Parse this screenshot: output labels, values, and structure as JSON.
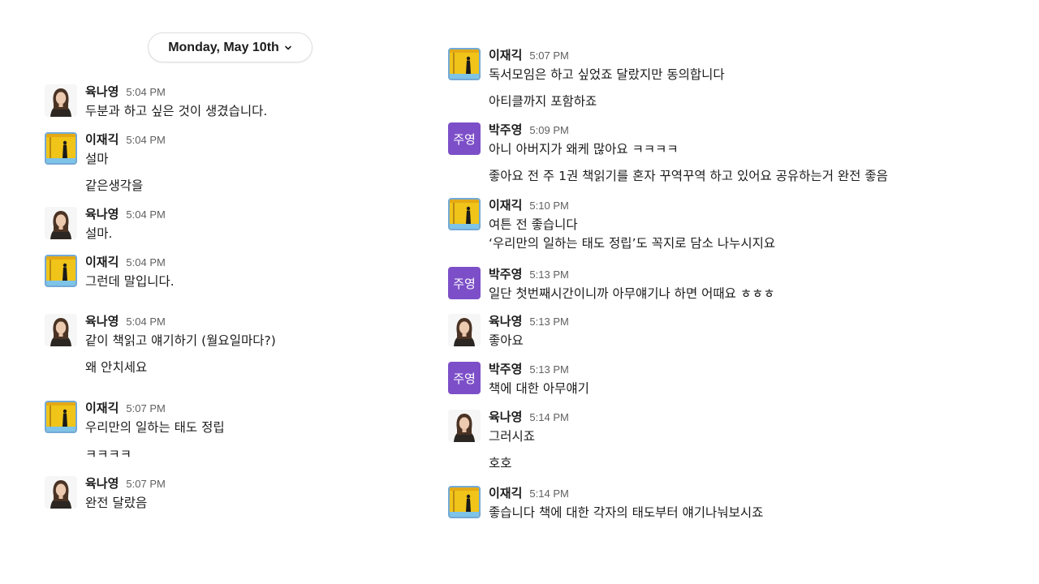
{
  "date_divider": {
    "label": "Monday, May 10th"
  },
  "avatar_labels": {
    "park": "주영"
  },
  "left_messages": [
    {
      "author": "육나영",
      "time": "5:04 PM",
      "avatar": "person",
      "lines": [
        "두분과 하고 싶은 것이 생겼습니다."
      ]
    },
    {
      "author": "이재긱",
      "time": "5:04 PM",
      "avatar": "art",
      "lines": [
        "설마",
        "같은생각을"
      ]
    },
    {
      "author": "육나영",
      "time": "5:04 PM",
      "avatar": "person",
      "lines": [
        "설마."
      ]
    },
    {
      "author": "이재긱",
      "time": "5:04 PM",
      "avatar": "art",
      "lines": [
        "그런데 말입니다."
      ]
    },
    {
      "author": "육나영",
      "time": "5:04 PM",
      "avatar": "person",
      "lines": [
        "같이 책읽고 얘기하기 (월요일마다?)",
        "왜 안치세요"
      ]
    },
    {
      "author": "이재긱",
      "time": "5:07 PM",
      "avatar": "art",
      "lines": [
        "우리만의 일하는 태도 정립",
        "ㅋㅋㅋㅋ"
      ]
    },
    {
      "author": "육나영",
      "time": "5:07 PM",
      "avatar": "person",
      "lines": [
        "완전 달랐음"
      ]
    }
  ],
  "right_messages": [
    {
      "author": "이재긱",
      "time": "5:07 PM",
      "avatar": "art",
      "lines": [
        "독서모임은 하고 싶었죠 달랐지만 동의합니다",
        "아티클까지 포함하죠"
      ]
    },
    {
      "author": "박주영",
      "time": "5:09 PM",
      "avatar": "text",
      "lines": [
        "아니 아버지가 왜케 많아요 ㅋㅋㅋㅋ",
        "좋아요 전 주 1권 책읽기를 혼자 꾸역꾸역 하고 있어요 공유하는거 완전 좋음"
      ]
    },
    {
      "author": "이재긱",
      "time": "5:10 PM",
      "avatar": "art",
      "lines": [
        "여튼 전 좋습니다",
        "‘우리만의 일하는 태도 정립’도 꼭지로 담소 나누시지요"
      ],
      "no_gap": true
    },
    {
      "author": "박주영",
      "time": "5:13 PM",
      "avatar": "text",
      "lines": [
        "일단 첫번째시간이니까 아무얘기나 하면 어때요 ㅎㅎㅎ"
      ]
    },
    {
      "author": "육나영",
      "time": "5:13 PM",
      "avatar": "person",
      "lines": [
        "좋아요"
      ]
    },
    {
      "author": "박주영",
      "time": "5:13 PM",
      "avatar": "text",
      "lines": [
        "책에 대한 아무얘기"
      ]
    },
    {
      "author": "육나영",
      "time": "5:14 PM",
      "avatar": "person",
      "lines": [
        "그러시죠",
        "호호"
      ]
    },
    {
      "author": "이재긱",
      "time": "5:14 PM",
      "avatar": "art",
      "lines": [
        "좋습니다 책에 대한 각자의 태도부터 얘기나눠보시죠"
      ]
    }
  ]
}
